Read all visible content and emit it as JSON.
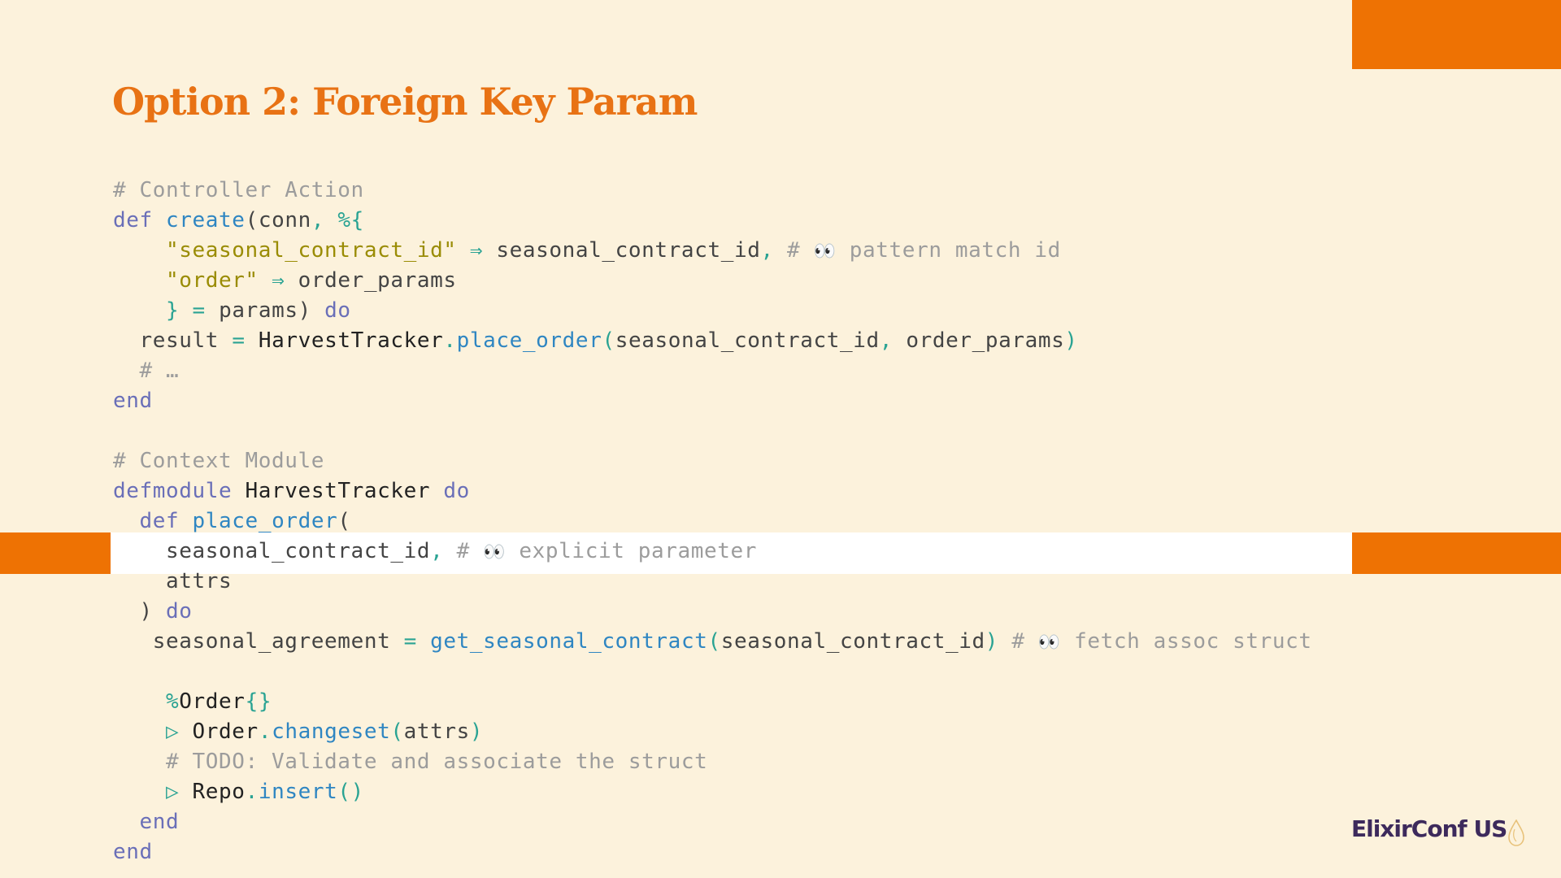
{
  "slide": {
    "title": "Option 2: Foreign Key Param",
    "logo_text": "ElixirConf US"
  },
  "colors": {
    "background": "#fcf2dc",
    "accent": "#ee7203",
    "title": "#e87214",
    "keyword": "#6a6fb8",
    "function": "#2f86c2",
    "string": "#9a8c05",
    "operator": "#2aa393",
    "comment": "#9c9c9c",
    "highlight_row": "#ffffff"
  },
  "icons": {
    "eyes": "eyes-emoji",
    "logo_drop": "elixir-drop-icon"
  },
  "code": {
    "l1": {
      "c": "# Controller Action"
    },
    "l2": {
      "def": "def",
      "fn": "create",
      "open": "(",
      "arg": "conn",
      "comma": ",",
      "map": "%{"
    },
    "l3": {
      "indent": "    ",
      "key": "\"seasonal_contract_id\"",
      "arrow": "⇒",
      "val": "seasonal_contract_id",
      "comma": ",",
      "cm_hash": "#",
      "cm_text": "pattern match id"
    },
    "l4": {
      "indent": "    ",
      "key": "\"order\"",
      "arrow": "⇒",
      "val": "order_params"
    },
    "l5": {
      "indent": "    ",
      "close": "}",
      "eq": "=",
      "params": "params",
      "paren": ")",
      "do": "do"
    },
    "l6": {
      "indent": "  ",
      "var": "result",
      "eq": "=",
      "mod": "HarvestTracker",
      "dot": ".",
      "fn": "place_order",
      "open": "(",
      "a1": "seasonal_contract_id",
      "comma": ",",
      "a2": "order_params",
      "close": ")"
    },
    "l7": {
      "indent": "  ",
      "c": "# …"
    },
    "l8": {
      "end": "end"
    },
    "l9": {},
    "l10": {
      "c": "# Context Module"
    },
    "l11": {
      "defmodule": "defmodule",
      "mod": "HarvestTracker",
      "do": "do"
    },
    "l12": {
      "indent": "  ",
      "def": "def",
      "fn": "place_order",
      "open": "("
    },
    "l13": {
      "indent": "    ",
      "arg": "seasonal_contract_id",
      "comma": ",",
      "cm_hash": "#",
      "cm_text": "explicit parameter"
    },
    "l14": {
      "indent": "    ",
      "arg": "attrs"
    },
    "l15": {
      "indent": "  ",
      "close": ")",
      "do": "do"
    },
    "l16": {
      "indent": "   ",
      "var": "seasonal_agreement",
      "eq": "=",
      "fn": "get_seasonal_contract",
      "open": "(",
      "arg": "seasonal_contract_id",
      "close": ")",
      "cm_hash": "#",
      "cm_text": "fetch assoc struct"
    },
    "l17": {},
    "l18": {
      "indent": "    ",
      "pct": "%",
      "mod": "Order",
      "braces": "{}"
    },
    "l19": {
      "indent": "    ",
      "pipe": "▷",
      "mod": "Order",
      "dot": ".",
      "fn": "changeset",
      "open": "(",
      "arg": "attrs",
      "close": ")"
    },
    "l20": {
      "indent": "    ",
      "c": "# TODO: Validate and associate the struct"
    },
    "l21": {
      "indent": "    ",
      "pipe": "▷",
      "mod": "Repo",
      "dot": ".",
      "fn": "insert",
      "parens": "()"
    },
    "l22": {
      "indent": "  ",
      "end": "end"
    },
    "l23": {
      "end": "end"
    }
  }
}
